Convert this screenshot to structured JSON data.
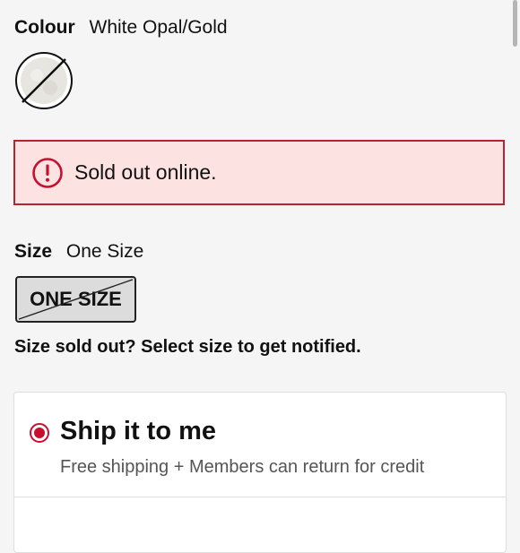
{
  "colour": {
    "label": "Colour",
    "value": "White Opal/Gold"
  },
  "sold_out_alert": {
    "message": "Sold out online.",
    "icon": "alert-circle-icon",
    "accent": "#b62431",
    "background": "#fde2e2"
  },
  "size": {
    "label": "Size",
    "value": "One Size",
    "option": "ONE SIZE"
  },
  "notify_text": "Size sold out? Select size to get notified.",
  "shipping": {
    "option_title": "Ship it to me",
    "option_subtitle": "Free shipping + Members can return for credit",
    "selected": true,
    "accent": "#c8102e"
  }
}
